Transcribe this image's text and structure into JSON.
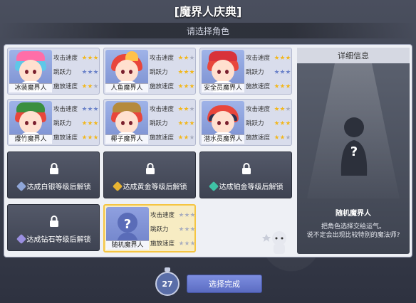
{
  "title": "[魔界人庆典]",
  "subtitle": "请选择角色",
  "stat_labels": [
    "攻击速度",
    "跳跃力",
    "施放速度"
  ],
  "characters": [
    {
      "name": "冰装魔界人",
      "hair": "#5ec7e8",
      "hat": "#ff6ea8",
      "stars": [
        [
          "gold",
          "gold",
          "gold"
        ],
        [
          "blue",
          "blue",
          "blue"
        ],
        [
          "gold",
          "gold",
          "gray"
        ]
      ]
    },
    {
      "name": "人鱼魔界人",
      "hair": "#e8463b",
      "hat": "#ffc14a",
      "stars": [
        [
          "gold",
          "gold",
          "gray"
        ],
        [
          "gold",
          "gold",
          "gold"
        ],
        [
          "gold",
          "gold",
          "gold"
        ]
      ]
    },
    {
      "name": "安全员魔界人",
      "hair": "#e8463b",
      "hat": "#d8323a",
      "stars": [
        [
          "gold",
          "gold",
          "gold"
        ],
        [
          "blue",
          "blue",
          "blue"
        ],
        [
          "gold",
          "gold",
          "gold"
        ]
      ]
    },
    {
      "name": "爆竹魔界人",
      "hair": "#e8463b",
      "hat": "#3a8f3f",
      "stars": [
        [
          "blue",
          "blue",
          "blue"
        ],
        [
          "gold",
          "gold",
          "gold"
        ],
        [
          "gold",
          "gold",
          "gold"
        ]
      ]
    },
    {
      "name": "椰子魔界人",
      "hair": "#e8463b",
      "hat": "#b58a3c",
      "stars": [
        [
          "gold",
          "gold",
          "gray"
        ],
        [
          "gold",
          "gold",
          "gold"
        ],
        [
          "gold",
          "gold",
          "gray"
        ]
      ]
    },
    {
      "name": "潜水员魔界人",
      "hair": "#e8463b",
      "hat": "#2e3150",
      "stars": [
        [
          "gold",
          "gold",
          "gray"
        ],
        [
          "gold",
          "gold",
          "gold"
        ],
        [
          "gold",
          "gold",
          "gray"
        ]
      ]
    }
  ],
  "locked": [
    {
      "text": "达成白银等级后解锁",
      "gem": "#8fa6d8"
    },
    {
      "text": "达成黄金等级后解锁",
      "gem": "#e8b432"
    },
    {
      "text": "达成铂金等级后解锁",
      "gem": "#3fc2a6"
    },
    {
      "text": "达成钻石等级后解锁",
      "gem": "#9a8fe0"
    }
  ],
  "random": {
    "name": "随机魔界人",
    "mark": "?"
  },
  "detail": {
    "header": "详细信息",
    "name": "随机魔界人",
    "desc_line1": "把角色选择交给运气。",
    "desc_line2": "说不定会出现比较特别的魔法师?",
    "mark": "?"
  },
  "timer": "27",
  "confirm_label": "选择完成"
}
